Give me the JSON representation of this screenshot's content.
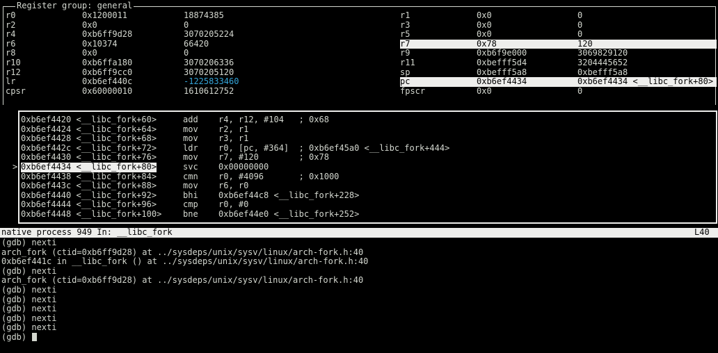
{
  "register_panel": {
    "title": "Register group: general",
    "left_column": [
      {
        "name": "r0",
        "hex": "0x1200011",
        "dec": "18874385"
      },
      {
        "name": "r2",
        "hex": "0x0",
        "dec": "0"
      },
      {
        "name": "r4",
        "hex": "0xb6ff9d28",
        "dec": "3070205224"
      },
      {
        "name": "r6",
        "hex": "0x10374",
        "dec": "66420"
      },
      {
        "name": "r8",
        "hex": "0x0",
        "dec": "0"
      },
      {
        "name": "r10",
        "hex": "0xb6ffa180",
        "dec": "3070206336"
      },
      {
        "name": "r12",
        "hex": "0xb6ff9cc0",
        "dec": "3070205120"
      },
      {
        "name": "lr",
        "hex": "0xb6ef440c",
        "dec": "-1225833460"
      },
      {
        "name": "cpsr",
        "hex": "0x60000010",
        "dec": "1610612752"
      }
    ],
    "right_column": [
      {
        "name": "r1",
        "hex": "0x0",
        "dec": "0"
      },
      {
        "name": "r3",
        "hex": "0x0",
        "dec": "0"
      },
      {
        "name": "r5",
        "hex": "0x0",
        "dec": "0"
      },
      {
        "name": "r7",
        "hex": "0x78",
        "dec": "120"
      },
      {
        "name": "r9",
        "hex": "0xb6f9e000",
        "dec": "3069829120"
      },
      {
        "name": "r11",
        "hex": "0xbefff5d4",
        "dec": "3204445652"
      },
      {
        "name": "sp",
        "hex": "0xbefff5a8",
        "dec": "0xbefff5a8"
      },
      {
        "name": "pc",
        "hex": "0xb6ef4434",
        "dec": "0xb6ef4434 <__libc_fork+80>"
      },
      {
        "name": "fpscr",
        "hex": "0x0",
        "dec": "0"
      }
    ]
  },
  "asm_panel": {
    "marker": ">",
    "rows": [
      {
        "addr": "0xb6ef4420 <__libc_fork+60>",
        "op": "add",
        "args": "r4, r12, #104   ; 0x68"
      },
      {
        "addr": "0xb6ef4424 <__libc_fork+64>",
        "op": "mov",
        "args": "r2, r1"
      },
      {
        "addr": "0xb6ef4428 <__libc_fork+68>",
        "op": "mov",
        "args": "r3, r1"
      },
      {
        "addr": "0xb6ef442c <__libc_fork+72>",
        "op": "ldr",
        "args": "r0, [pc, #364]  ; 0xb6ef45a0 <__libc_fork+444>"
      },
      {
        "addr": "0xb6ef4430 <__libc_fork+76>",
        "op": "mov",
        "args": "r7, #120        ; 0x78"
      },
      {
        "addr": "0xb6ef4434 <__libc_fork+80>",
        "op": "svc",
        "args": "0x00000000"
      },
      {
        "addr": "0xb6ef4438 <__libc_fork+84>",
        "op": "cmn",
        "args": "r0, #4096       ; 0x1000"
      },
      {
        "addr": "0xb6ef443c <__libc_fork+88>",
        "op": "mov",
        "args": "r6, r0"
      },
      {
        "addr": "0xb6ef4440 <__libc_fork+92>",
        "op": "bhi",
        "args": "0xb6ef44c8 <__libc_fork+228>"
      },
      {
        "addr": "0xb6ef4444 <__libc_fork+96>",
        "op": "cmp",
        "args": "r0, #0"
      },
      {
        "addr": "0xb6ef4448 <__libc_fork+100>",
        "op": "bne",
        "args": "0xb6ef44e0 <__libc_fork+252>"
      }
    ]
  },
  "status_bar": {
    "left": "native process 949 In: __libc_fork",
    "right": "L40"
  },
  "command_output": [
    "(gdb) nexti",
    "arch_fork (ctid=0xb6ff9d28) at ../sysdeps/unix/sysv/linux/arch-fork.h:40",
    "0xb6ef441c in __libc_fork () at ../sysdeps/unix/sysv/linux/arch-fork.h:40",
    "(gdb) nexti",
    "arch_fork (ctid=0xb6ff9d28) at ../sysdeps/unix/sysv/linux/arch-fork.h:40",
    "(gdb) nexti",
    "(gdb) nexti",
    "(gdb) nexti",
    "(gdb) nexti",
    "(gdb) nexti"
  ],
  "prompt": "(gdb) ",
  "colors": {
    "background": "#000000",
    "foreground": "#d3d7cf",
    "highlight": "#eeeeec",
    "negative_value": "#34a4d8"
  }
}
